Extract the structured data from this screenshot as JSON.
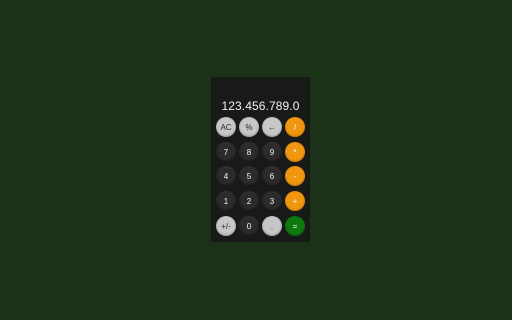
{
  "display": {
    "value": "123.456.789.0"
  },
  "keys": {
    "ac": "AC",
    "percent": "%",
    "backspace": "←",
    "divide": "/",
    "seven": "7",
    "eight": "8",
    "nine": "9",
    "multiply": "*",
    "four": "4",
    "five": "5",
    "six": "6",
    "minus": "-",
    "one": "1",
    "two": "2",
    "three": "3",
    "plus": "+",
    "sign": "+/-",
    "zero": "0",
    "decimal": ".",
    "equals": "="
  },
  "colors": {
    "page_background": "#1b3118",
    "calculator_body": "#171a17",
    "function_key": "#c7c7c7",
    "number_key": "#2b2b2b",
    "operator_key": "#f0960f",
    "equals_key": "#0e7a0d"
  }
}
